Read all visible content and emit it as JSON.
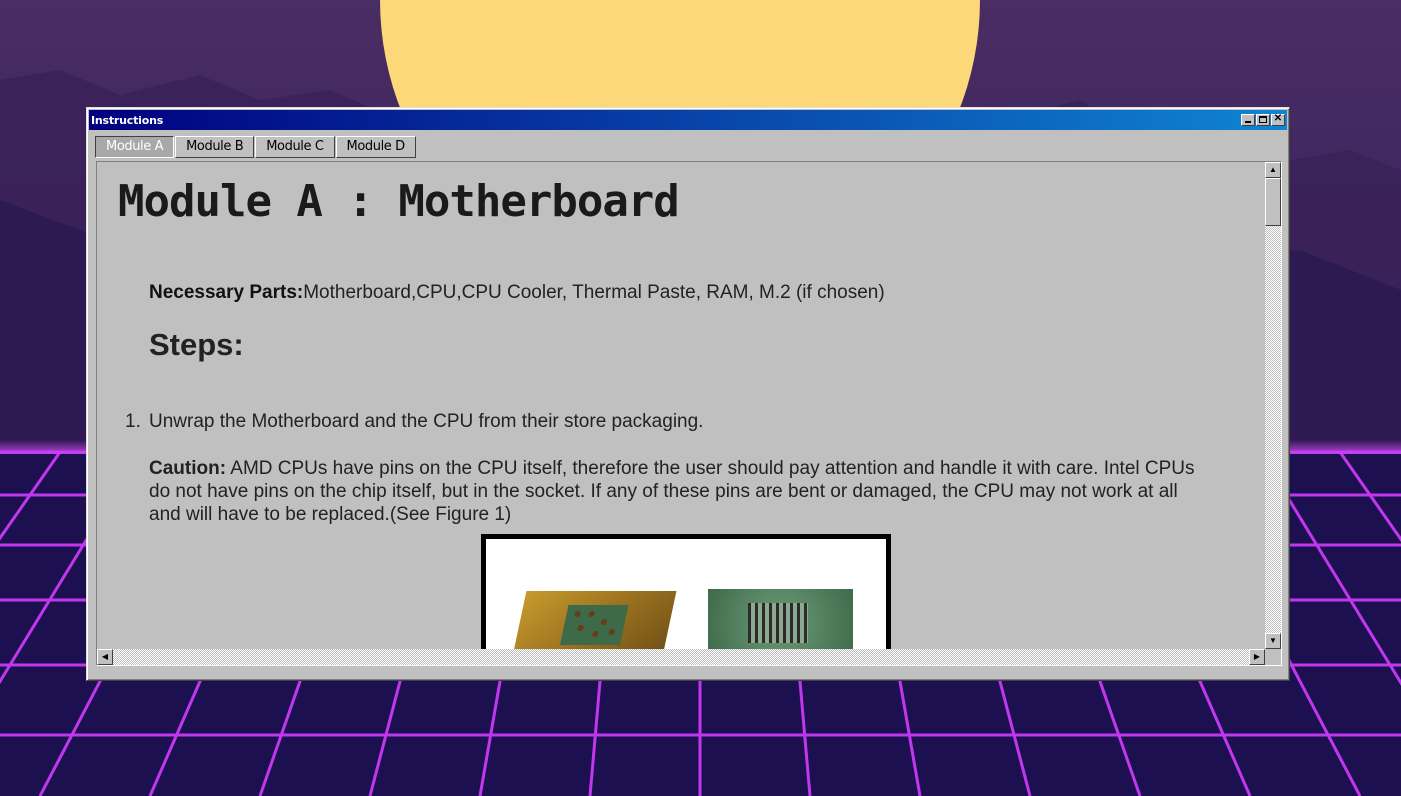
{
  "window": {
    "title": "Instructions"
  },
  "tabs": [
    {
      "label": "Module A"
    },
    {
      "label": "Module B"
    },
    {
      "label": "Module C"
    },
    {
      "label": "Module D"
    }
  ],
  "content": {
    "heading": "Module A : Motherboard",
    "parts_label": "Necessary Parts:",
    "parts_text": "Motherboard,CPU,CPU Cooler, Thermal Paste, RAM, M.2 (if chosen)",
    "steps_heading": "Steps:",
    "step1_num": "1.",
    "step1_text": "Unwrap the Motherboard and the CPU from their store packaging.",
    "caution_label": "Caution:",
    "caution_text": " AMD CPUs have pins on the CPU itself, therefore the user should pay attention and handle it with care. Intel CPUs do not have pins on the chip itself, but in the socket. If any of these pins are bent or damaged, the CPU may not work at all and will have to be replaced.(See Figure 1)"
  },
  "icons": {
    "minimize": "minimize-icon",
    "maximize": "maximize-icon",
    "close": "close-icon",
    "close_glyph": "✕",
    "scroll_up": "▲",
    "scroll_down": "▼",
    "scroll_left": "◀",
    "scroll_right": "▶"
  },
  "colors": {
    "titlebar_start": "#000080",
    "titlebar_end": "#1084d0",
    "window_bg": "#c0c0c0",
    "sun": "#fcd878",
    "grid_neon": "#d23cff"
  }
}
